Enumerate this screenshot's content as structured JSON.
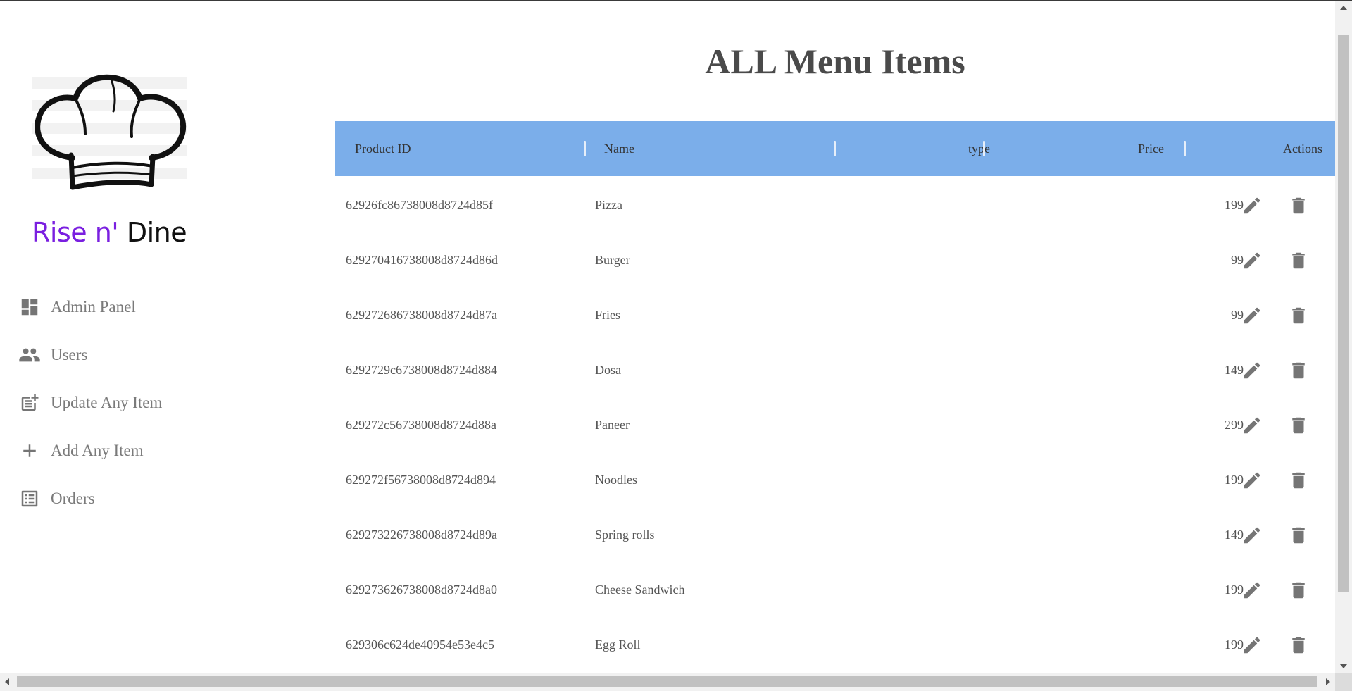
{
  "brand": {
    "part1": "Rise n'",
    "part2": "Dine"
  },
  "sidebar": {
    "items": [
      {
        "label": "Admin Panel",
        "icon": "dashboard-icon"
      },
      {
        "label": "Users",
        "icon": "people-icon"
      },
      {
        "label": "Update Any Item",
        "icon": "post-add-icon"
      },
      {
        "label": "Add Any Item",
        "icon": "plus-icon"
      },
      {
        "label": "Orders",
        "icon": "list-alt-icon"
      }
    ]
  },
  "main": {
    "title": "ALL Menu Items",
    "columns": {
      "id": "Product ID",
      "name": "Name",
      "type": "type",
      "price": "Price",
      "actions": "Actions"
    },
    "rows": [
      {
        "id": "62926fc86738008d8724d85f",
        "name": "Pizza",
        "type": "",
        "price": "199"
      },
      {
        "id": "629270416738008d8724d86d",
        "name": "Burger",
        "type": "",
        "price": "99"
      },
      {
        "id": "629272686738008d8724d87a",
        "name": "Fries",
        "type": "",
        "price": "99"
      },
      {
        "id": "6292729c6738008d8724d884",
        "name": "Dosa",
        "type": "",
        "price": "149"
      },
      {
        "id": "629272c56738008d8724d88a",
        "name": "Paneer",
        "type": "",
        "price": "299"
      },
      {
        "id": "629272f56738008d8724d894",
        "name": "Noodles",
        "type": "",
        "price": "199"
      },
      {
        "id": "629273226738008d8724d89a",
        "name": "Spring rolls",
        "type": "",
        "price": "149"
      },
      {
        "id": "629273626738008d8724d8a0",
        "name": "Cheese Sandwich",
        "type": "",
        "price": "199"
      },
      {
        "id": "629306c624de40954e53e4c5",
        "name": "Egg Roll",
        "type": "",
        "price": "199"
      }
    ]
  },
  "colors": {
    "accent": "#7a1fe0",
    "header_bg": "#7baeea",
    "icon_gray": "#757575"
  },
  "icons": {
    "edit": "pencil-icon",
    "delete": "trash-icon",
    "logo": "chef-hat-icon"
  }
}
